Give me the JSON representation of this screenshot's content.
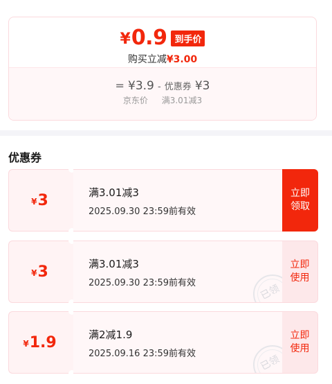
{
  "price_summary": {
    "currency_symbol": "¥",
    "final_price": "0.9",
    "final_tag": "到手价",
    "reduce_label": "购买立减",
    "reduce_amount": "¥3.00",
    "formula_eq": "=",
    "formula_jd_price": "¥3.9",
    "formula_minus": "-",
    "formula_coupon_label": "优惠券",
    "formula_coupon_amount": "¥3",
    "label_jd_price": "京东价",
    "label_coupon_rule": "满3.01减3"
  },
  "section": {
    "title": "优惠券"
  },
  "coupons": [
    {
      "symbol": "¥",
      "amount": "3",
      "rule": "满3.01减3",
      "validity": "2025.09.30 23:59前有效",
      "action": "立即领取",
      "action_line1": "立即",
      "action_line2": "领取",
      "claimed": false
    },
    {
      "symbol": "¥",
      "amount": "3",
      "rule": "满3.01减3",
      "validity": "2025.09.30 23:59前有效",
      "action": "立即使用",
      "action_line1": "立即",
      "action_line2": "使用",
      "claimed": true,
      "stamp": "已领"
    },
    {
      "symbol": "¥",
      "amount": "1.9",
      "rule": "满2减1.9",
      "validity": "2025.09.16 23:59前有效",
      "action": "立即使用",
      "action_line1": "立即",
      "action_line2": "使用",
      "claimed": true,
      "stamp": "已领"
    }
  ],
  "colors": {
    "accent": "#f2270c",
    "coupon_bg": "#fff7f8",
    "border": "#fbd9dd"
  }
}
